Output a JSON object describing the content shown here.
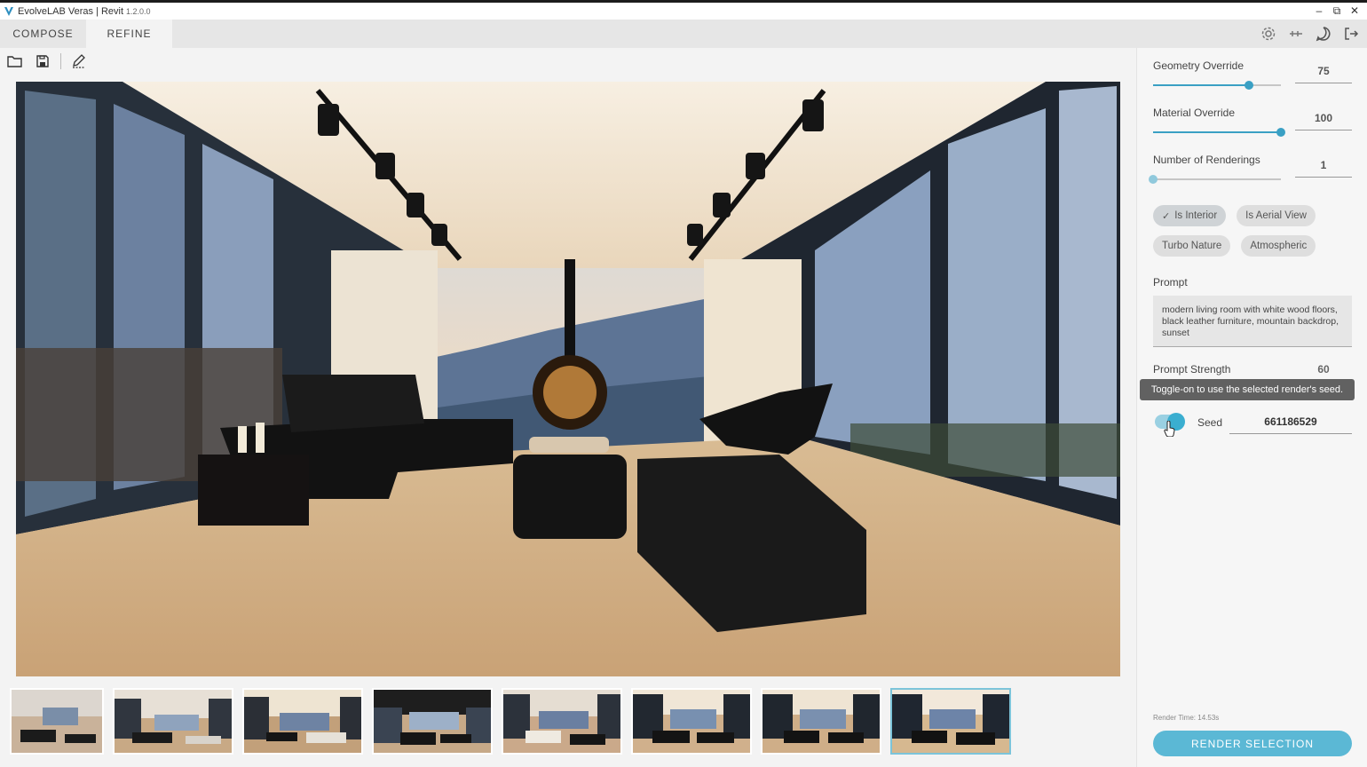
{
  "window": {
    "title": "EvolveLAB Veras | Revit",
    "version": "1.2.0.0",
    "controls": [
      "minimize",
      "restore",
      "close"
    ]
  },
  "tabs": [
    {
      "label": "COMPOSE",
      "active": false
    },
    {
      "label": "REFINE",
      "active": true
    }
  ],
  "top_icons": [
    "gear-icon",
    "sliders-icon",
    "chat-icon",
    "logout-icon"
  ],
  "toolbar": [
    "folder-open-icon",
    "save-icon",
    "edit-icon"
  ],
  "main_image": {
    "subject": "modern living room render"
  },
  "thumbnails": {
    "count": 8,
    "selected_index": 7
  },
  "panel": {
    "geometry_override": {
      "label": "Geometry Override",
      "value": "75",
      "percent": 75
    },
    "material_override": {
      "label": "Material Override",
      "value": "100",
      "percent": 100
    },
    "num_renderings": {
      "label": "Number of Renderings",
      "value": "1",
      "percent": 0
    },
    "chips": [
      {
        "label": "Is Interior",
        "checked": true
      },
      {
        "label": "Is Aerial View",
        "checked": false
      },
      {
        "label": "Turbo Nature",
        "checked": false
      },
      {
        "label": "Atmospheric",
        "checked": false
      }
    ],
    "prompt_label": "Prompt",
    "prompt_text": "modern living room with white wood floors, black leather furniture, mountain backdrop, sunset",
    "prompt_strength_label": "Prompt Strength",
    "prompt_strength_value": "60",
    "tooltip": "Toggle-on to use the selected render's seed.",
    "seed_label": "Seed",
    "seed_value": "661186529",
    "seed_toggle_on": true,
    "render_time": "Render Time: 14.53s",
    "render_button": "RENDER SELECTION"
  },
  "colors": {
    "accent": "#3aa0c4",
    "button": "#5bb8d5",
    "tooltip": "#616161"
  }
}
